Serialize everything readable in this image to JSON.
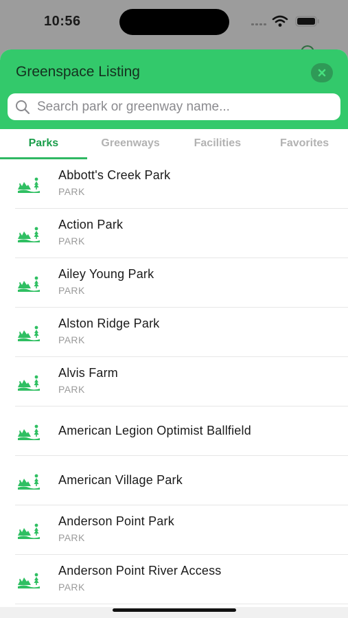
{
  "status_bar": {
    "time": "10:56"
  },
  "sheet": {
    "title": "Greenspace Listing",
    "search": {
      "placeholder": "Search park or greenway name...",
      "value": ""
    }
  },
  "tabs": [
    {
      "label": "Parks",
      "active": true
    },
    {
      "label": "Greenways",
      "active": false
    },
    {
      "label": "Facilities",
      "active": false
    },
    {
      "label": "Favorites",
      "active": false
    }
  ],
  "items": [
    {
      "name": "Abbott's Creek Park",
      "type": "PARK"
    },
    {
      "name": "Action Park",
      "type": "PARK"
    },
    {
      "name": "Ailey Young Park",
      "type": "PARK"
    },
    {
      "name": "Alston Ridge Park",
      "type": "PARK"
    },
    {
      "name": "Alvis Farm",
      "type": "PARK"
    },
    {
      "name": "American Legion Optimist Ballfield",
      "type": ""
    },
    {
      "name": "American Village Park",
      "type": ""
    },
    {
      "name": "Anderson Point Park",
      "type": "PARK"
    },
    {
      "name": "Anderson Point River Access",
      "type": "PARK"
    }
  ],
  "icons": {
    "item": "park-trees-icon",
    "search": "search-icon",
    "close": "close-icon"
  },
  "colors": {
    "header": "#33c96b",
    "accent": "#1a9d4a",
    "icon": "#2fbf62"
  }
}
